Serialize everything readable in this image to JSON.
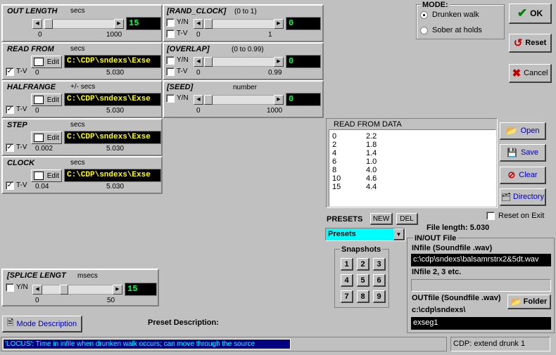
{
  "panels": {
    "out_length": {
      "title": "OUT LENGTH",
      "unit": "secs",
      "min": "0",
      "max": "1000",
      "value": "15"
    },
    "rand_clock": {
      "title": "[RAND_CLOCK]",
      "range": "(0 to 1)",
      "yn": "Y/N",
      "tv": "T-V",
      "min": "0",
      "max": "1",
      "value": "0"
    },
    "read_from": {
      "title": "READ FROM",
      "unit": "secs",
      "edit": "Edit",
      "path": "C:\\CDP\\sndexs\\Exse",
      "tv": "T-V",
      "min": "0",
      "max": "5.030"
    },
    "overlap": {
      "title": "[OVERLAP]",
      "range": "(0 to 0.99)",
      "yn": "Y/N",
      "tv": "T-V",
      "min": "0",
      "max": "0.99",
      "value": "0"
    },
    "halfrange": {
      "title": "HALFRANGE",
      "unit": "+/- secs",
      "edit": "Edit",
      "path": "C:\\CDP\\sndexs\\Exse",
      "tv": "T-V",
      "min": "0",
      "max": "5.030"
    },
    "seed": {
      "title": "[SEED]",
      "unit": "number",
      "yn": "Y/N",
      "min": "0",
      "max": "1000",
      "value": "0"
    },
    "step": {
      "title": "STEP",
      "unit": "secs",
      "edit": "Edit",
      "path": "C:\\CDP\\sndexs\\Exse",
      "tv": "T-V",
      "min": "0.002",
      "max": "5.030"
    },
    "clock": {
      "title": "CLOCK",
      "unit": "secs",
      "edit": "Edit",
      "path": "C:\\CDP\\sndexs\\Exse",
      "tv": "T-V",
      "min": "0.04",
      "max": "5.030"
    },
    "splice": {
      "title": "[SPLICE LENGT",
      "unit": "msecs",
      "yn": "Y/N",
      "min": "0",
      "max": "50",
      "value": "15"
    }
  },
  "mode": {
    "title": "MODE:",
    "options": [
      "Drunken walk",
      "Sober at holds"
    ],
    "selected": 0
  },
  "buttons": {
    "ok": "OK",
    "reset": "Reset",
    "cancel": "Cancel"
  },
  "read_data": {
    "header": "READ FROM  DATA",
    "rows": [
      [
        "0",
        "2.2"
      ],
      [
        "2",
        "1.8"
      ],
      [
        "4",
        "1.4"
      ],
      [
        "6",
        "1.0"
      ],
      [
        "8",
        "4.0"
      ],
      [
        "10",
        "4.6"
      ],
      [
        "15",
        "4.4"
      ]
    ]
  },
  "file_buttons": {
    "open": "Open",
    "save": "Save",
    "clear": "Clear",
    "directory": "Directory"
  },
  "presets": {
    "label": "PRESETS",
    "new": "NEW",
    "del": "DEL",
    "selected": "Presets",
    "reset_on_exit": "Reset on Exit"
  },
  "file_length": "File length:  5.030",
  "snapshots": {
    "title": "Snapshots",
    "labels": [
      "1",
      "2",
      "3",
      "4",
      "5",
      "6",
      "7",
      "8",
      "9"
    ]
  },
  "inout": {
    "title": "IN/OUT File",
    "infile_label": "INfile (Soundfile .wav)",
    "infile_value": "c:\\cdp\\sndexs\\balsamrstrx2&5dt.wav",
    "infile2_label": "INfile 2, 3 etc.",
    "infile2_value": "",
    "outfile_label": "OUTfile (Soundfile .wav)",
    "folder": "Folder",
    "outdir": "c:\\cdp\\sndexs\\",
    "outfile_value": "exseg1"
  },
  "mode_description": "Mode Description",
  "preset_description": "Preset Description:",
  "status": "'LOCUS': Time in infile when drunken walk occurs; can move through the source",
  "status_right": "CDP: extend drunk 1"
}
